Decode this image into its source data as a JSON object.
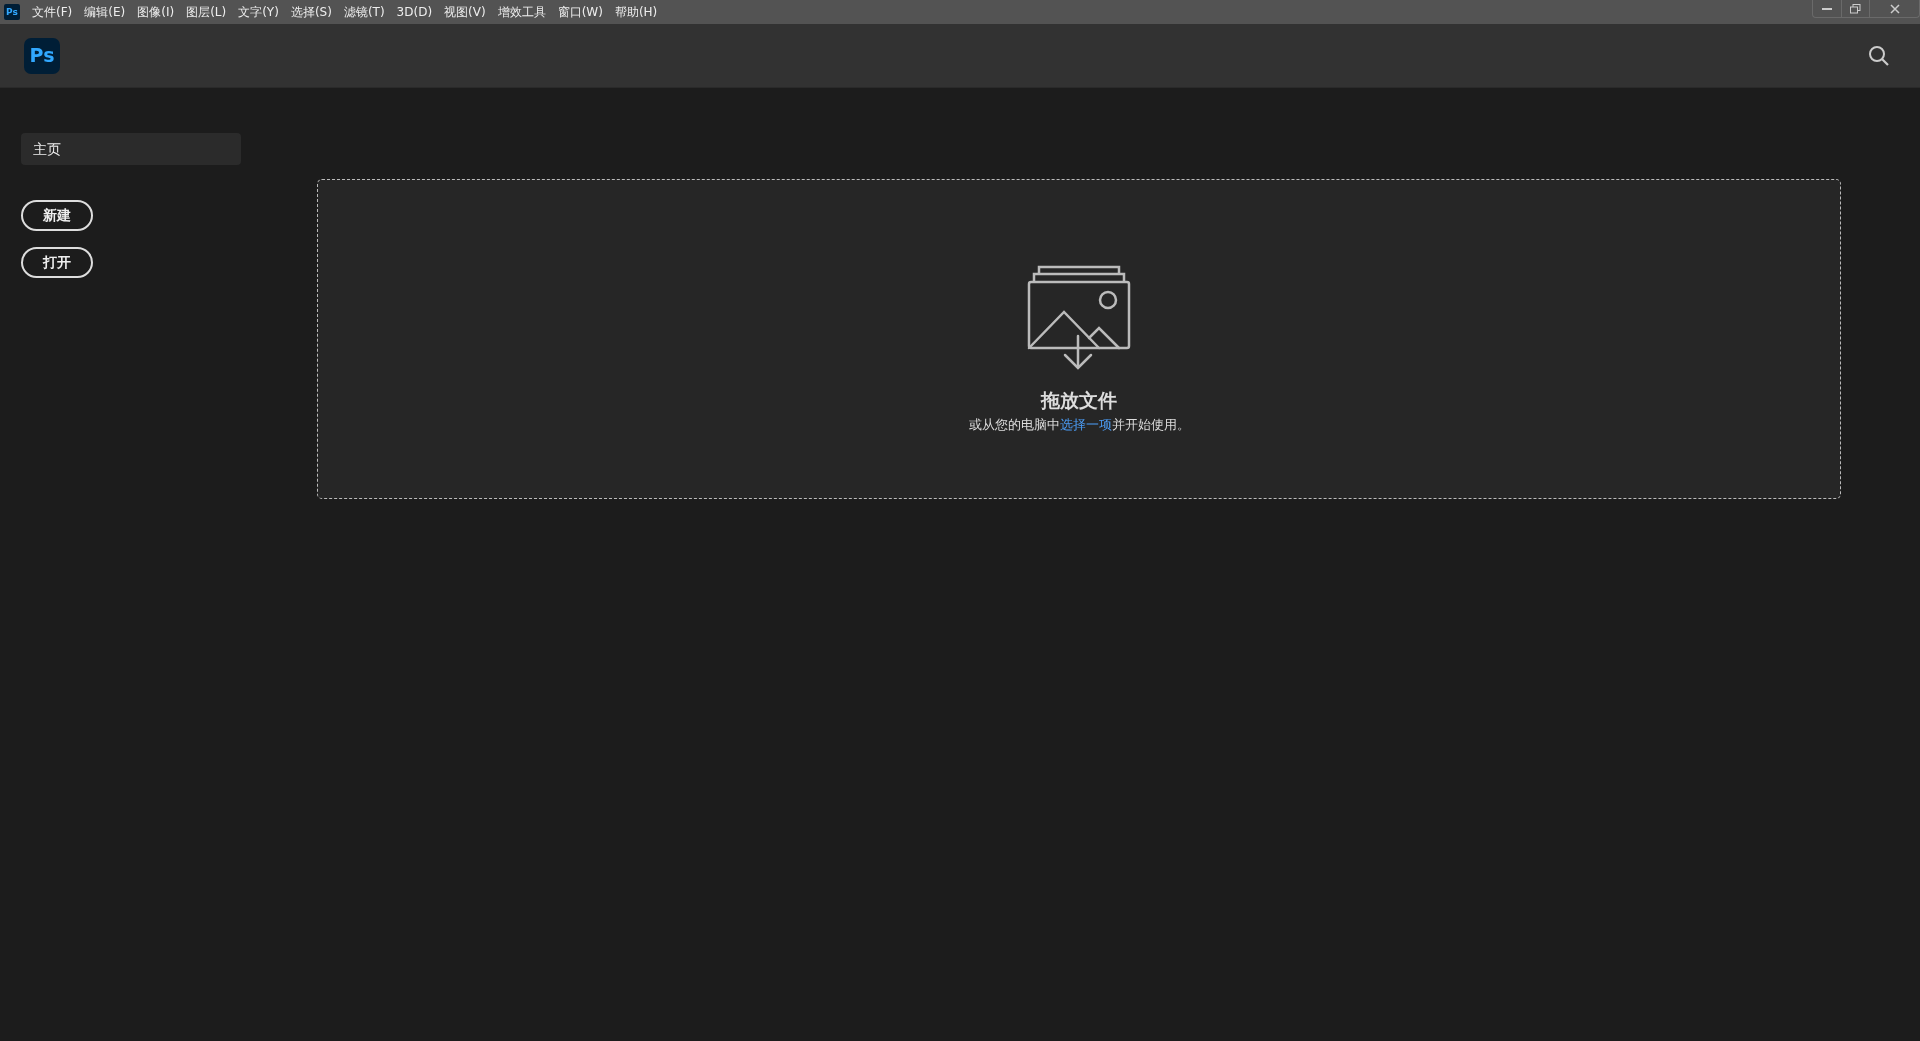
{
  "menu_bar": {
    "app_icon": "Ps",
    "items": [
      "文件(F)",
      "编辑(E)",
      "图像(I)",
      "图层(L)",
      "文字(Y)",
      "选择(S)",
      "滤镜(T)",
      "3D(D)",
      "视图(V)",
      "增效工具",
      "窗口(W)",
      "帮助(H)"
    ]
  },
  "header": {
    "logo": "Ps"
  },
  "sidebar": {
    "items": [
      {
        "label": "主页",
        "selected": true
      }
    ],
    "buttons": [
      "新建",
      "打开"
    ]
  },
  "drop_zone": {
    "title": "拖放文件",
    "subtitle_before": "或从您的电脑中",
    "subtitle_link": "选择一项",
    "subtitle_after": "并开始使用。"
  }
}
